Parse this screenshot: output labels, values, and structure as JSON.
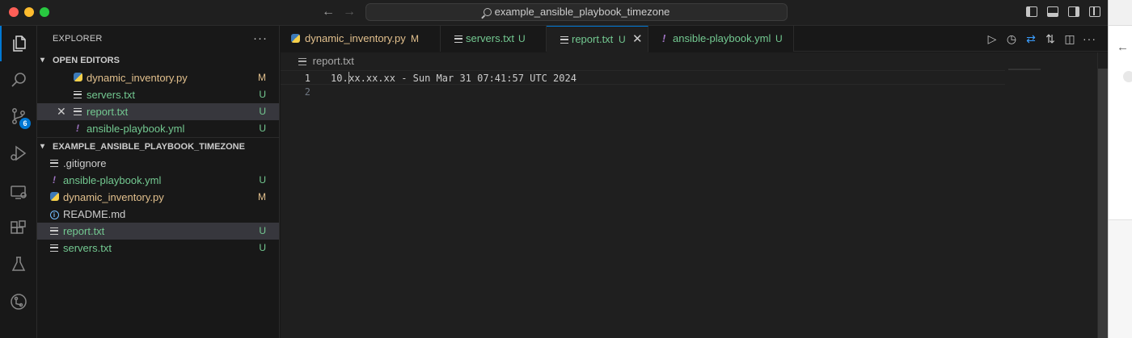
{
  "titlebar": {
    "search_text": "example_ansible_playbook_timezone",
    "back_icon": "arrow-left-icon",
    "forward_icon": "arrow-right-icon"
  },
  "activitybar": {
    "items": [
      {
        "name": "explorer-icon",
        "active": true
      },
      {
        "name": "search-icon"
      },
      {
        "name": "source-control-icon",
        "badge": "6"
      },
      {
        "name": "run-debug-icon"
      },
      {
        "name": "remote-explorer-icon"
      },
      {
        "name": "extensions-icon"
      },
      {
        "name": "testing-icon"
      },
      {
        "name": "git-graph-icon"
      }
    ]
  },
  "sidebar": {
    "title": "EXPLORER",
    "more": "···",
    "open_editors": {
      "header": "OPEN EDITORS",
      "items": [
        {
          "name": "dynamic_inventory.py",
          "status": "M",
          "kind": "py"
        },
        {
          "name": "servers.txt",
          "status": "U",
          "kind": "txt"
        },
        {
          "name": "report.txt",
          "status": "U",
          "kind": "txt"
        },
        {
          "name": "ansible-playbook.yml",
          "status": "U",
          "kind": "yml"
        }
      ]
    },
    "folder": {
      "header": "EXAMPLE_ANSIBLE_PLAYBOOK_TIMEZONE",
      "items": [
        {
          "name": ".gitignore",
          "status": "",
          "kind": "txt"
        },
        {
          "name": "ansible-playbook.yml",
          "status": "U",
          "kind": "yml"
        },
        {
          "name": "dynamic_inventory.py",
          "status": "M",
          "kind": "py"
        },
        {
          "name": "README.md",
          "status": "",
          "kind": "info"
        },
        {
          "name": "report.txt",
          "status": "U",
          "kind": "txt"
        },
        {
          "name": "servers.txt",
          "status": "U",
          "kind": "txt"
        }
      ]
    }
  },
  "tabs": [
    {
      "label": "dynamic_inventory.py",
      "status": "M"
    },
    {
      "label": "servers.txt",
      "status": "U"
    },
    {
      "label": "report.txt",
      "status": "U",
      "active": true
    },
    {
      "label": "ansible-playbook.yml",
      "status": "U"
    }
  ],
  "editor": {
    "breadcrumb": "report.txt",
    "lines": [
      {
        "number": "1",
        "text_before_cursor": "10.",
        "text_after_cursor": "xx.xx.xx - Sun Mar 31 07:41:57 UTC 2024"
      },
      {
        "number": "2",
        "text": ""
      }
    ]
  },
  "colors": {
    "accent": "#0078d4",
    "modified": "#e2c08d",
    "untracked": "#73c991"
  }
}
